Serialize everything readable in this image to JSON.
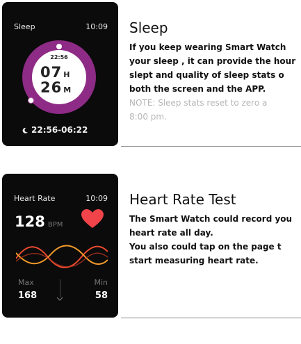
{
  "sleep": {
    "watch": {
      "title": "Sleep",
      "time": "10:09",
      "start_time": "22:56",
      "hours": "07",
      "hours_unit": "H",
      "minutes": "26",
      "minutes_unit": "M",
      "range": "22:56-06:22",
      "ring_color": "#8e2b86",
      "icon": "moon-icon"
    },
    "title": "Sleep",
    "lines": [
      "If you keep wearing Smart Watch",
      "your sleep , it can provide the hour",
      "slept and quality of sleep stats o",
      "both the screen and the APP."
    ],
    "note_lines": [
      "NOTE: Sleep stats reset to zero a",
      "8:00 pm."
    ]
  },
  "heart_rate": {
    "watch": {
      "title": "Heart Rate",
      "time": "10:09",
      "bpm": "128",
      "bpm_unit": "BPM",
      "max_label": "Max",
      "max_value": "168",
      "min_label": "Min",
      "min_value": "58",
      "heart_color": "#f0434a",
      "icon": "heart-icon"
    },
    "title": "Heart Rate Test",
    "lines": [
      "The Smart Watch could record you",
      "heart rate all day.",
      "You also could tap on the page t",
      "start measuring heart rate."
    ]
  }
}
